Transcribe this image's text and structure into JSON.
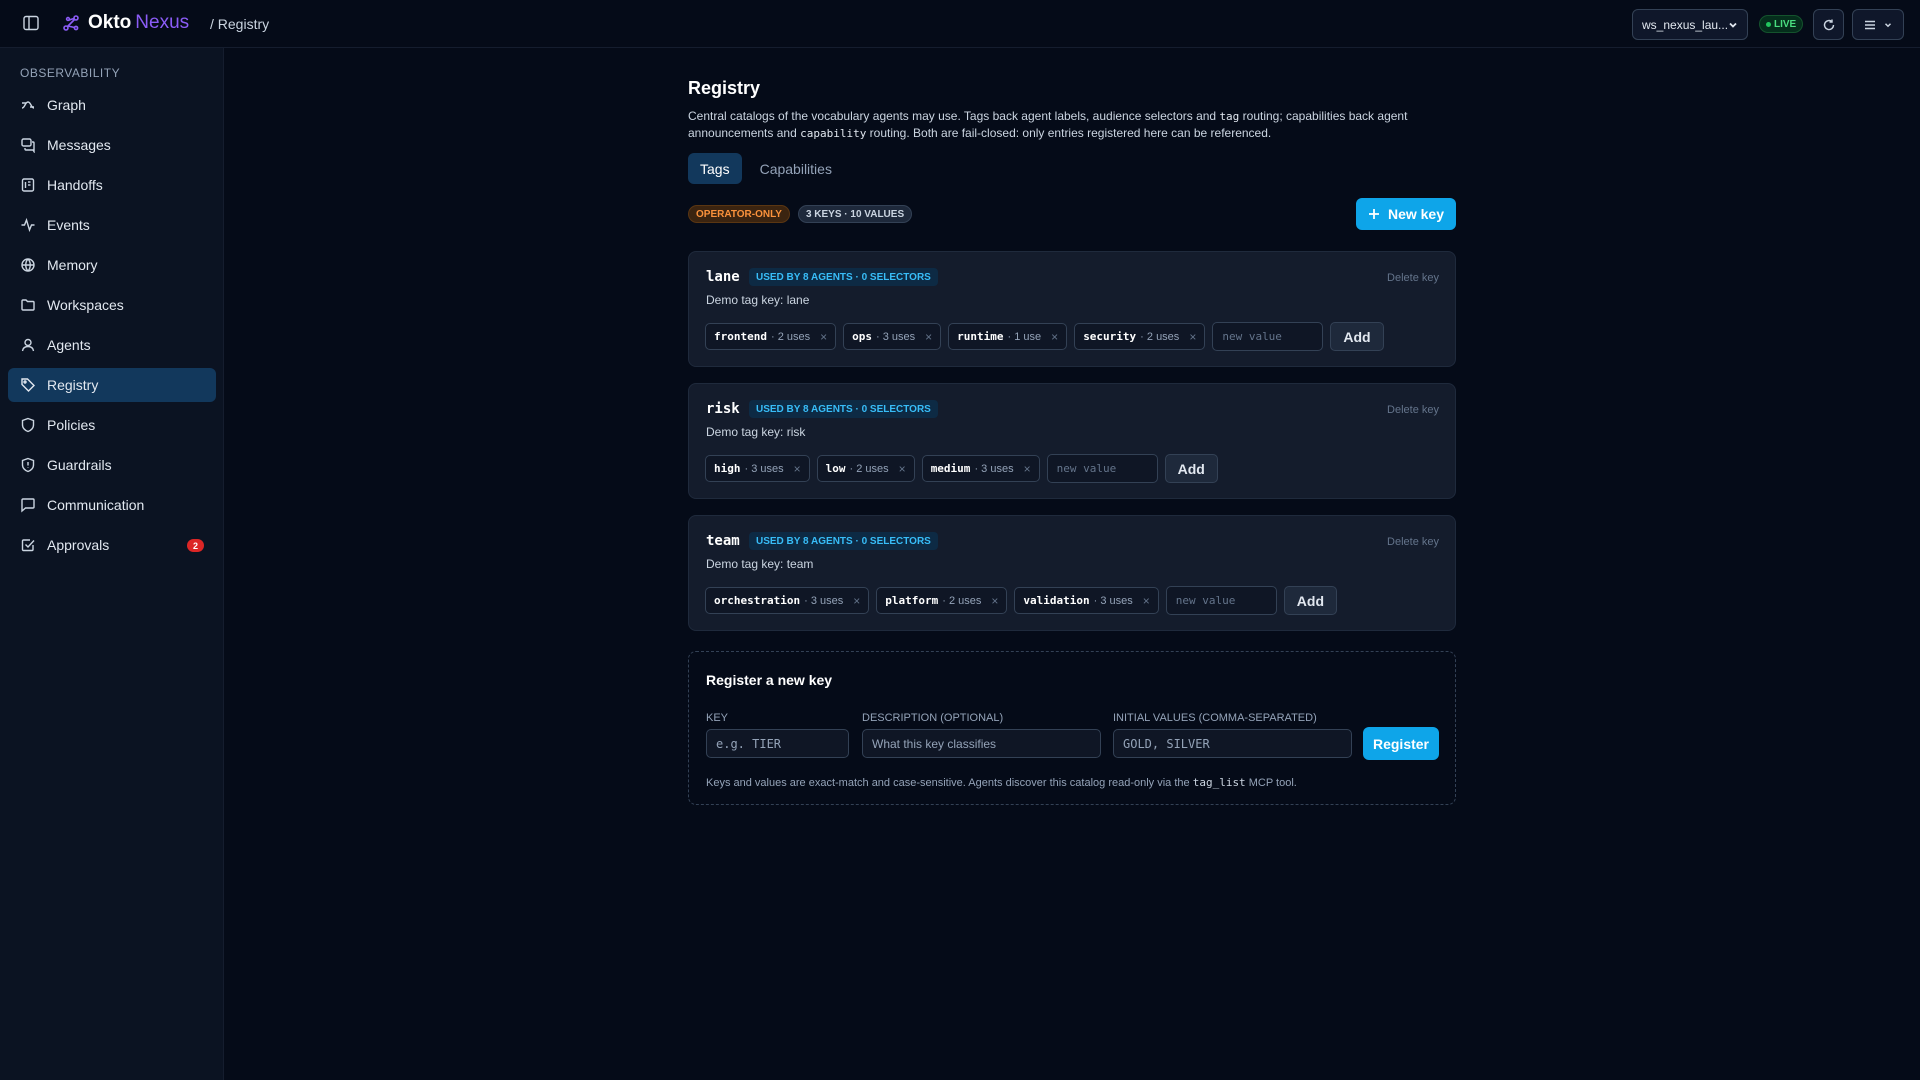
{
  "brand": {
    "name": "Okto",
    "product": "Nexus"
  },
  "breadcrumb": "/ Registry",
  "topbar": {
    "workspace": "ws_nexus_lau...",
    "live_label": "LIVE"
  },
  "sidebar": {
    "heading": "OBSERVABILITY",
    "items": [
      {
        "label": "Graph",
        "icon": "graph-icon"
      },
      {
        "label": "Messages",
        "icon": "messages-icon"
      },
      {
        "label": "Handoffs",
        "icon": "handoffs-icon"
      },
      {
        "label": "Events",
        "icon": "events-icon"
      },
      {
        "label": "Memory",
        "icon": "memory-icon"
      },
      {
        "label": "Workspaces",
        "icon": "folder-icon"
      },
      {
        "label": "Agents",
        "icon": "user-icon"
      },
      {
        "label": "Registry",
        "icon": "tag-icon",
        "active": true
      },
      {
        "label": "Policies",
        "icon": "shield-icon"
      },
      {
        "label": "Guardrails",
        "icon": "shield-alert-icon"
      },
      {
        "label": "Communication",
        "icon": "chat-icon"
      },
      {
        "label": "Approvals",
        "icon": "check-square-icon",
        "badge": "2"
      }
    ]
  },
  "page": {
    "title": "Registry",
    "desc": {
      "p1": "Central catalogs of the vocabulary agents may use. Tags back agent labels, audience selectors and ",
      "c1": "tag",
      "p2": " routing; capabilities back agent announcements and ",
      "c2": "capability",
      "p3": " routing. Both are fail-closed: only entries registered here can be referenced."
    },
    "tabs": [
      "Tags",
      "Capabilities"
    ],
    "badge_operator": "OPERATOR-ONLY",
    "badge_count": "3 KEYS · 10 VALUES",
    "new_key_label": "New key"
  },
  "keys": [
    {
      "key": "lane",
      "used": "USED BY 8 AGENTS · 0 SELECTORS",
      "delete_label": "Delete key",
      "desc": "Demo tag key: lane",
      "values": [
        {
          "val": "frontend",
          "uses": "· 2 uses"
        },
        {
          "val": "ops",
          "uses": "· 3 uses"
        },
        {
          "val": "runtime",
          "uses": "· 1 use"
        },
        {
          "val": "security",
          "uses": "· 2 uses"
        }
      ],
      "placeholder": "new value",
      "add_label": "Add"
    },
    {
      "key": "risk",
      "used": "USED BY 8 AGENTS · 0 SELECTORS",
      "delete_label": "Delete key",
      "desc": "Demo tag key: risk",
      "values": [
        {
          "val": "high",
          "uses": "· 3 uses"
        },
        {
          "val": "low",
          "uses": "· 2 uses"
        },
        {
          "val": "medium",
          "uses": "· 3 uses"
        }
      ],
      "placeholder": "new value",
      "add_label": "Add"
    },
    {
      "key": "team",
      "used": "USED BY 8 AGENTS · 0 SELECTORS",
      "delete_label": "Delete key",
      "desc": "Demo tag key: team",
      "values": [
        {
          "val": "orchestration",
          "uses": "· 3 uses"
        },
        {
          "val": "platform",
          "uses": "· 2 uses"
        },
        {
          "val": "validation",
          "uses": "· 3 uses"
        }
      ],
      "placeholder": "new value",
      "add_label": "Add"
    }
  ],
  "register": {
    "title": "Register a new key",
    "key_label": "KEY",
    "key_placeholder": "e.g. TIER",
    "desc_label": "DESCRIPTION (OPTIONAL)",
    "desc_placeholder": "What this key classifies",
    "values_label": "INITIAL VALUES (COMMA-SEPARATED)",
    "values_placeholder": "GOLD, SILVER",
    "button": "Register",
    "note_p1": "Keys and values are exact-match and case-sensitive. Agents discover this catalog read-only via the ",
    "note_code": "tag_list",
    "note_p2": " MCP tool."
  },
  "colors": {
    "accent": "#0ea5e9",
    "brand_purple": "#8b5cf6",
    "live_green": "#22c55e",
    "operator_orange": "#fb923c",
    "badge_red": "#dc2626"
  }
}
